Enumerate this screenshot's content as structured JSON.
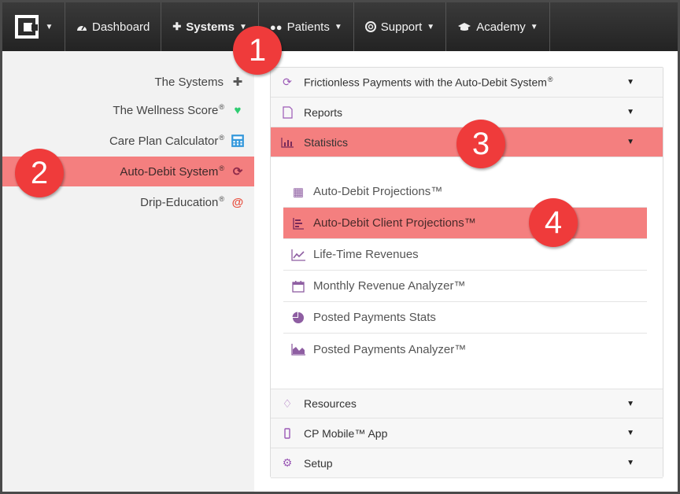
{
  "navbar": {
    "items": [
      {
        "label": "Dashboard",
        "icon": "dashboard-icon"
      },
      {
        "label": "Systems",
        "icon": "puzzle-icon"
      },
      {
        "label": "Patients",
        "icon": "users-icon"
      },
      {
        "label": "Support",
        "icon": "lifebuoy-icon"
      },
      {
        "label": "Academy",
        "icon": "graduation-cap-icon"
      }
    ]
  },
  "sidebar": {
    "items": [
      {
        "label": "The Systems",
        "reg": "",
        "icon": "puzzle-icon"
      },
      {
        "label": "The Wellness Score",
        "reg": "®",
        "icon": "heartbeat-icon"
      },
      {
        "label": "Care Plan Calculator",
        "reg": "®",
        "icon": "calculator-icon"
      },
      {
        "label": "Auto-Debit System",
        "reg": "®",
        "icon": "refresh-icon"
      },
      {
        "label": "Drip-Education",
        "reg": "®",
        "icon": "at-icon"
      }
    ]
  },
  "panel": {
    "sections": [
      {
        "label": "Frictionless Payments with the Auto-Debit System",
        "reg": "®",
        "icon": "refresh-icon"
      },
      {
        "label": "Reports",
        "reg": "",
        "icon": "file-icon"
      },
      {
        "label": "Statistics",
        "reg": "",
        "icon": "bar-chart-icon"
      },
      {
        "label": "Resources",
        "reg": "",
        "icon": "diamond-icon"
      },
      {
        "label": "CP Mobile™ App",
        "reg": "",
        "icon": "mobile-icon"
      },
      {
        "label": "Setup",
        "reg": "",
        "icon": "cogs-icon"
      }
    ],
    "statistics_items": [
      {
        "label": "Auto-Debit Projections™",
        "icon": "calendar-icon"
      },
      {
        "label": "Auto-Debit Client Projections™",
        "icon": "list-chart-icon"
      },
      {
        "label": "Life-Time Revenues",
        "icon": "line-chart-icon"
      },
      {
        "label": "Monthly Revenue Analyzer™",
        "icon": "calendar-empty-icon"
      },
      {
        "label": "Posted Payments Stats",
        "icon": "pie-chart-icon"
      },
      {
        "label": "Posted Payments Analyzer™",
        "icon": "area-chart-icon"
      }
    ]
  },
  "callouts": [
    "1",
    "2",
    "3",
    "4"
  ],
  "colors": {
    "highlight": "#f47f7f",
    "badge": "#ef3b3b",
    "navbar": "#2a2a2a",
    "icon_purple": "#9b59b6"
  }
}
